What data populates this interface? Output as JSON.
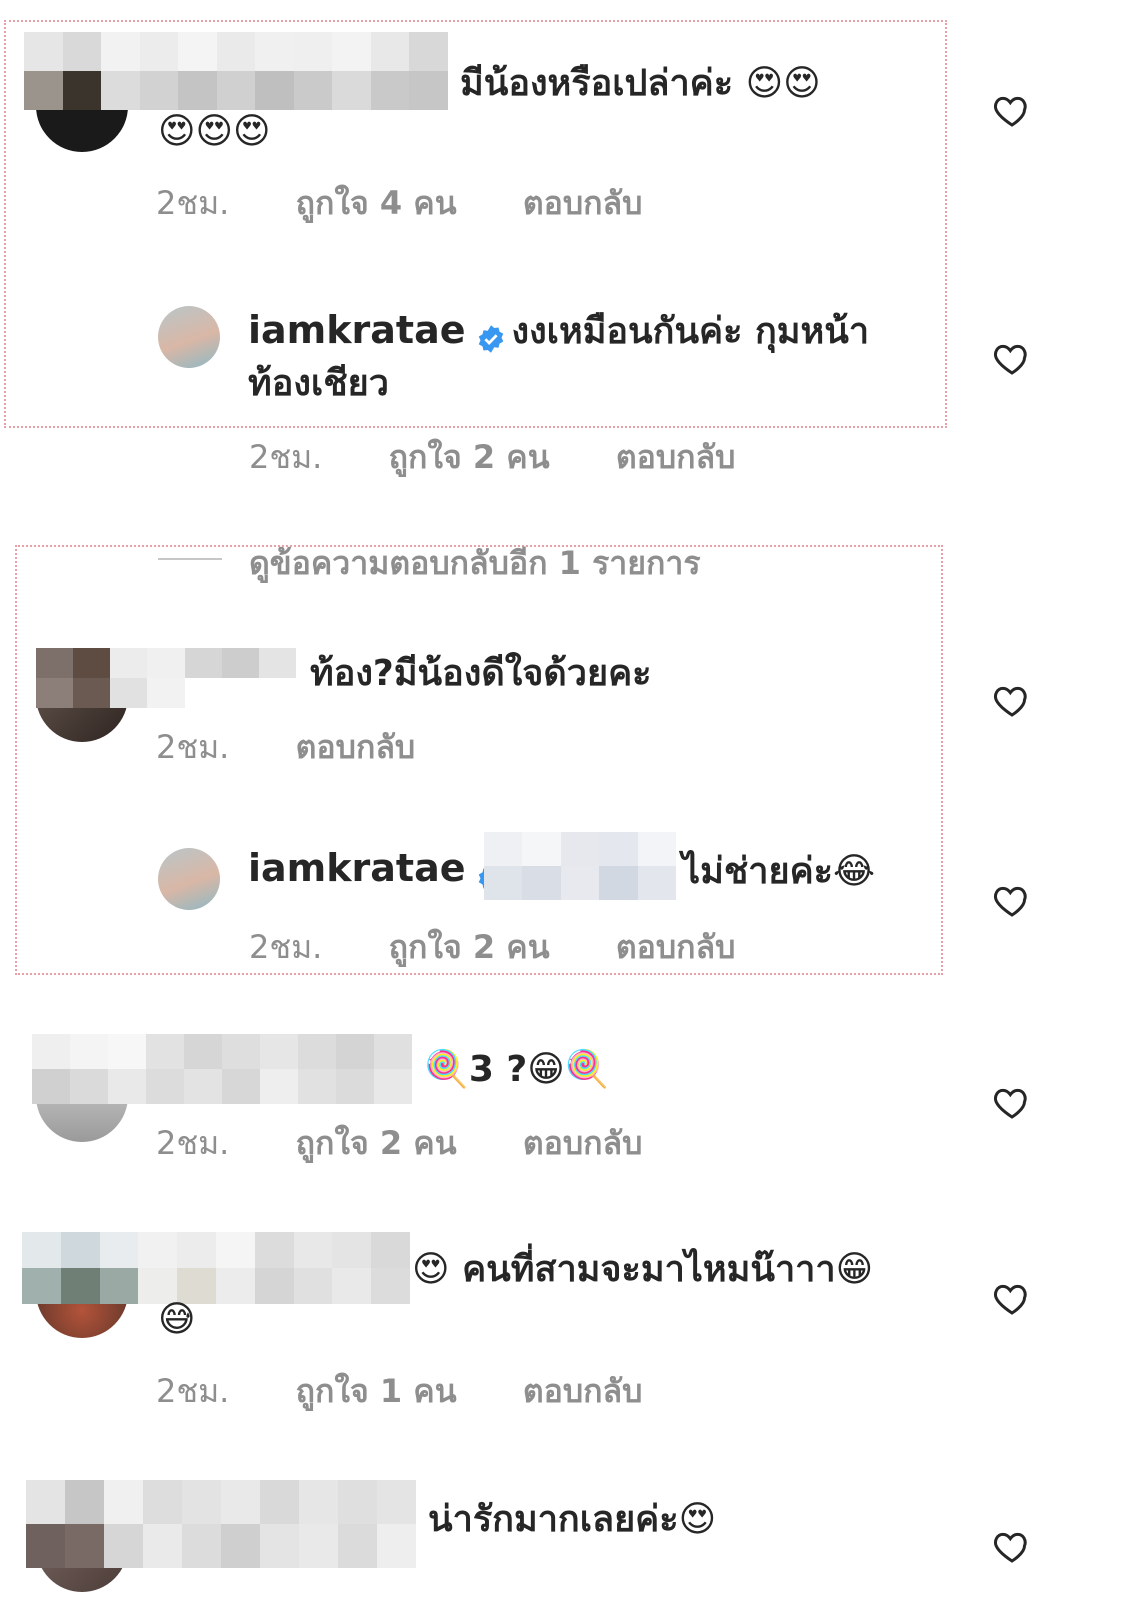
{
  "comments": [
    {
      "text": "มีน้องหรือเปล่าค่ะ 😍😍",
      "text_line2": "😍😍😍",
      "time": "2ชม.",
      "likes": "ถูกใจ 4 คน",
      "reply": "ตอบกลับ"
    },
    {
      "username": "iamkratae",
      "text": "งงเหมือนกันค่ะ กุมหน้า",
      "text_line2": "ท้องเชียว",
      "time": "2ชม.",
      "likes": "ถูกใจ 2 คน",
      "reply": "ตอบกลับ"
    },
    {
      "view_replies": "ดูข้อความตอบกลับอีก 1 รายการ"
    },
    {
      "text": "ท้อง?มีน้องดีใจด้วยคะ",
      "time": "2ชม.",
      "reply": "ตอบกลับ"
    },
    {
      "username": "iamkratae",
      "text": "ไม่ช่ายค่ะ😂",
      "time": "2ชม.",
      "likes": "ถูกใจ 2 คน",
      "reply": "ตอบกลับ"
    },
    {
      "text": "🍭3 ?😁🍭",
      "time": "2ชม.",
      "likes": "ถูกใจ 2 คน",
      "reply": "ตอบกลับ"
    },
    {
      "text": "😍 คนที่สามจะมาไหมน๊าาา😁",
      "text_line2": "😅",
      "time": "2ชม.",
      "likes": "ถูกใจ 1 คน",
      "reply": "ตอบกลับ"
    },
    {
      "text": "น่ารักมากเลยค่ะ😍"
    }
  ],
  "colors": {
    "text": "#262626",
    "meta": "#8e8e8e",
    "verified": "#3897f0",
    "highlight_border": "#e8a0a8"
  },
  "icons": {
    "like": "heart-outline-icon",
    "verified": "verified-badge-icon"
  }
}
